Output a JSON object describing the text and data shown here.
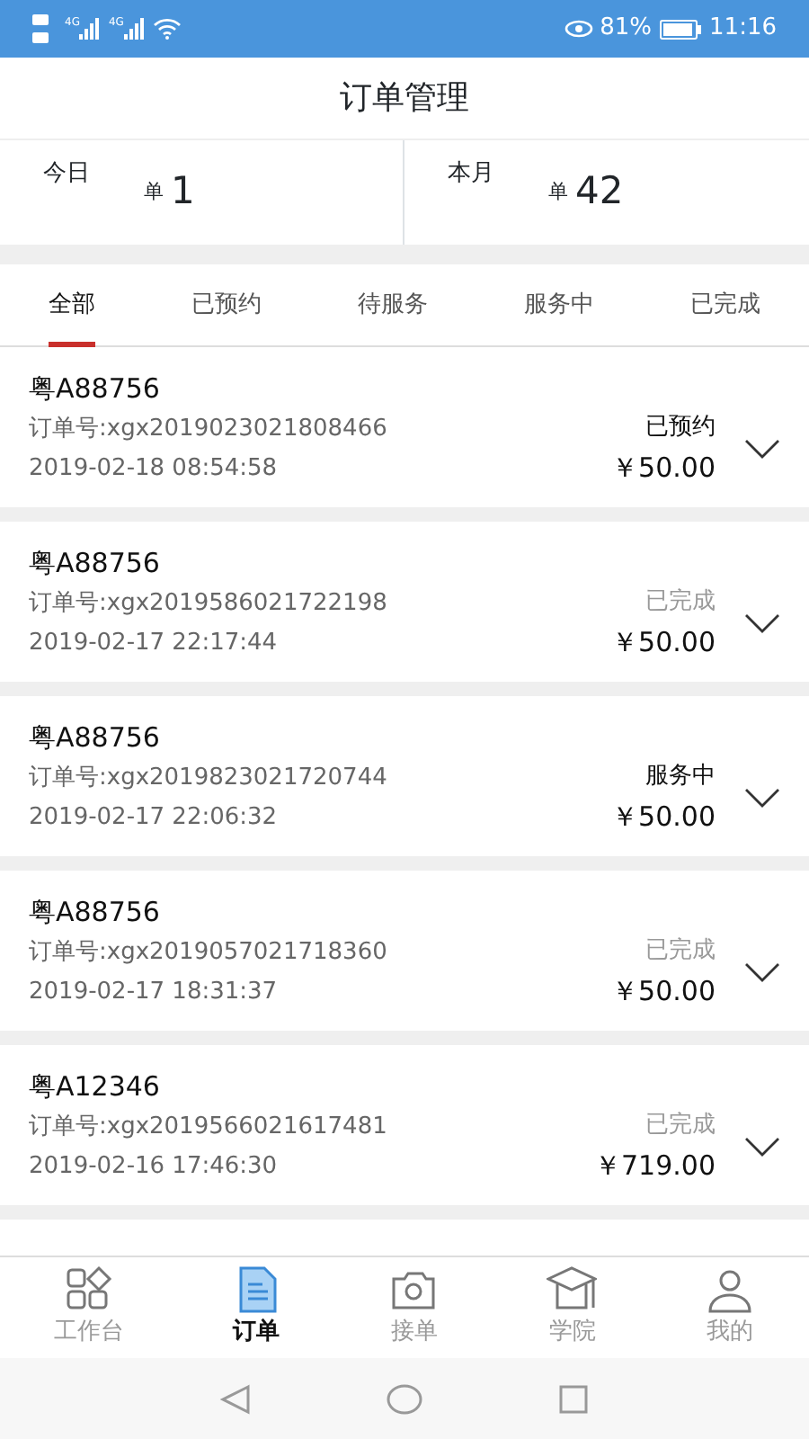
{
  "status_bar": {
    "network_labels": [
      "4G",
      "4G"
    ],
    "battery_percent": "81%",
    "time": "11:16"
  },
  "title": "订单管理",
  "stats": [
    {
      "label": "今日",
      "unit": "单",
      "count": "1"
    },
    {
      "label": "本月",
      "unit": "单",
      "count": "42"
    }
  ],
  "tabs": [
    {
      "label": "全部",
      "selected": true
    },
    {
      "label": "已预约",
      "selected": false
    },
    {
      "label": "待服务",
      "selected": false
    },
    {
      "label": "服务中",
      "selected": false
    },
    {
      "label": "已完成",
      "selected": false
    }
  ],
  "orders": [
    {
      "plate": "粤A88756",
      "order_no": "订单号:xgx2019023021808466",
      "time": "2019-02-18 08:54:58",
      "status": "已预约",
      "finished": false,
      "price": "￥50.00"
    },
    {
      "plate": "粤A88756",
      "order_no": "订单号:xgx2019586021722198",
      "time": "2019-02-17 22:17:44",
      "status": "已完成",
      "finished": true,
      "price": "￥50.00"
    },
    {
      "plate": "粤A88756",
      "order_no": "订单号:xgx2019823021720744",
      "time": "2019-02-17 22:06:32",
      "status": "服务中",
      "finished": false,
      "price": "￥50.00"
    },
    {
      "plate": "粤A88756",
      "order_no": "订单号:xgx2019057021718360",
      "time": "2019-02-17 18:31:37",
      "status": "已完成",
      "finished": true,
      "price": "￥50.00"
    },
    {
      "plate": "粤A12346",
      "order_no": "订单号:xgx2019566021617481",
      "time": "2019-02-16 17:46:30",
      "status": "已完成",
      "finished": true,
      "price": "￥719.00"
    }
  ],
  "bottom_nav": [
    {
      "label": "工作台",
      "kind": "grid",
      "selected": false
    },
    {
      "label": "订单",
      "kind": "doc",
      "selected": true
    },
    {
      "label": "接单",
      "kind": "camera",
      "selected": false
    },
    {
      "label": "学院",
      "kind": "cap",
      "selected": false
    },
    {
      "label": "我的",
      "kind": "person",
      "selected": false
    }
  ]
}
